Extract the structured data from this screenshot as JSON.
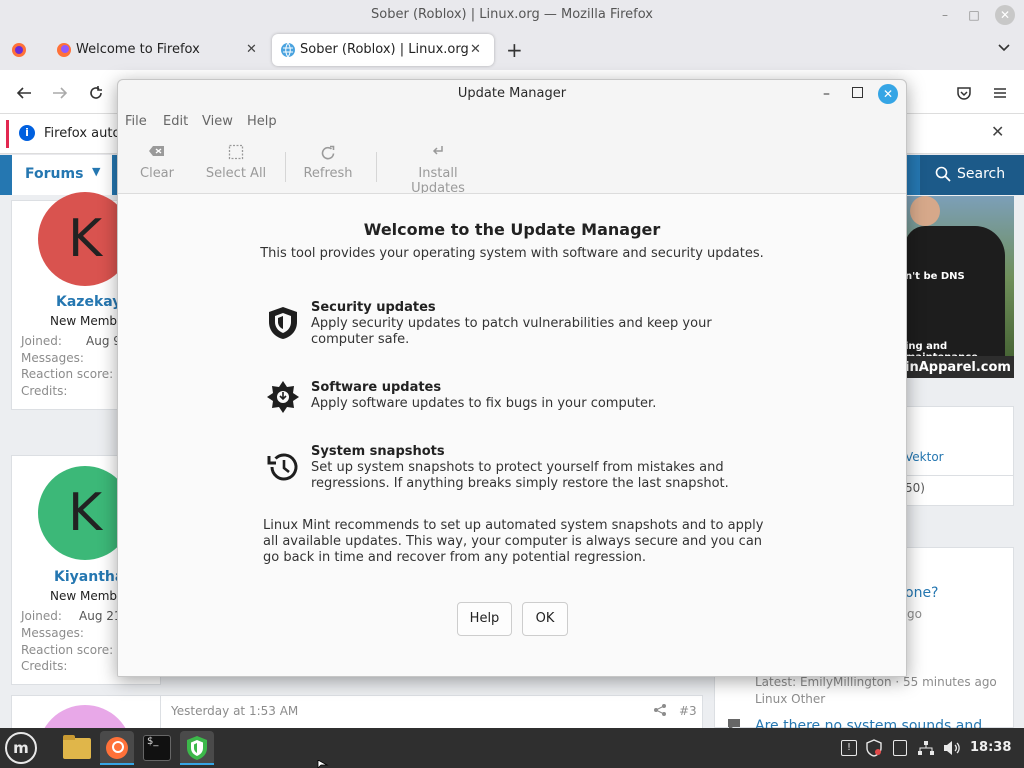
{
  "browser": {
    "window_title": "Sober (Roblox) | Linux.org — Mozilla Firefox",
    "tabs": [
      {
        "label": "Welcome to Firefox"
      },
      {
        "label": "Sober (Roblox) | Linux.org"
      }
    ],
    "notification_text": "Firefox auto"
  },
  "forum": {
    "nav_label": "Forums",
    "search_label": "Search",
    "users": [
      {
        "initial": "K",
        "name": "Kazekay",
        "title": "New Member",
        "joined_label": "Joined:",
        "joined_value": "Aug 9",
        "messages_label": "Messages:",
        "reaction_label": "Reaction score:",
        "credits_label": "Credits:",
        "color": "#d9534f"
      },
      {
        "initial": "K",
        "name": "Kiyantha",
        "title": "New Member",
        "joined_label": "Joined:",
        "joined_value": "Aug 21",
        "messages_label": "Messages:",
        "reaction_label": "Reaction score:",
        "credits_label": "Credits:",
        "color": "#3cb878"
      }
    ],
    "post_time": "Yesterday at 1:53 AM",
    "post_number": "#3",
    "ad_shirt_text": "n't be DNS",
    "ad_caption": "ing and maintenance.",
    "ad_brand": "inApparel.com",
    "side_link": "Vektor",
    "side_count": "50)",
    "side_question": "one?",
    "side_ago": "go",
    "latest_text": "Latest: EmilyMillington · 55 minutes ago",
    "latest_forum": "Linux Other",
    "next_thread": "Are there no system sounds and"
  },
  "update_manager": {
    "title": "Update Manager",
    "menu": [
      "File",
      "Edit",
      "View",
      "Help"
    ],
    "toolbar": {
      "clear": "Clear",
      "select_all": "Select All",
      "refresh": "Refresh",
      "install": "Install Updates"
    },
    "heading": "Welcome to the Update Manager",
    "subheading": "This tool provides your operating system with software and security updates.",
    "features": [
      {
        "title": "Security updates",
        "desc": "Apply security updates to patch vulnerabilities and keep your computer safe."
      },
      {
        "title": "Software updates",
        "desc": "Apply software updates to fix bugs in your computer."
      },
      {
        "title": "System snapshots",
        "desc": "Set up system snapshots to protect yourself from mistakes and regressions. If anything breaks simply restore the last snapshot."
      }
    ],
    "recommendation": "Linux Mint recommends to set up automated system snapshots and to apply all available updates. This way, your computer is always secure and you can go back in time and recover from any potential regression.",
    "help_button": "Help",
    "ok_button": "OK"
  },
  "taskbar": {
    "clock": "18:38"
  }
}
